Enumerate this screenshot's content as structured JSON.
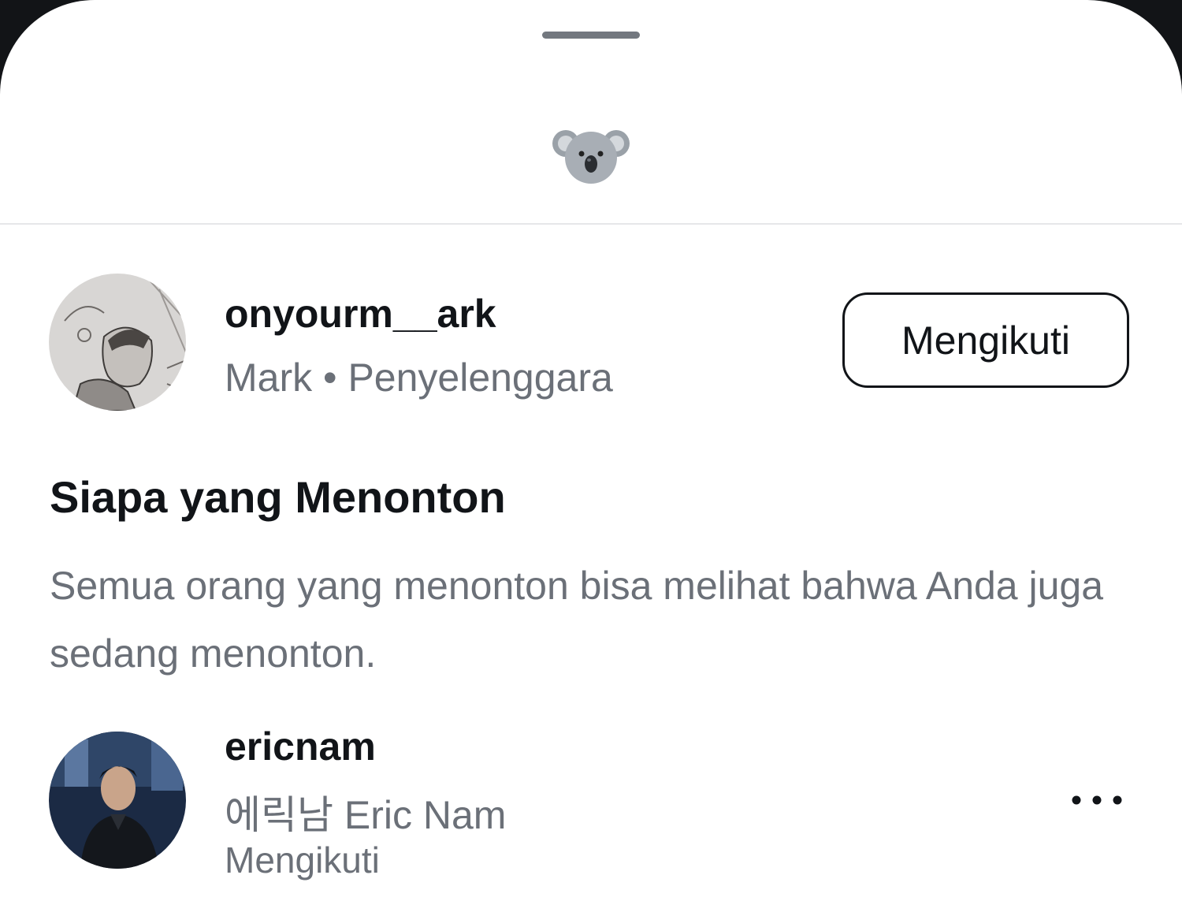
{
  "header": {
    "emoji": "🐨",
    "emoji_icon": "koala-icon"
  },
  "host": {
    "username": "onyourm__ark",
    "name": "Mark",
    "separator": "•",
    "role": "Penyelenggara",
    "follow_label": "Mengikuti"
  },
  "section": {
    "title": "Siapa yang Menonton",
    "description": "Semua orang yang menonton bisa melihat bahwa Anda juga sedang menonton."
  },
  "viewers": [
    {
      "username": "ericnam",
      "display_name": "에릭남 Eric Nam",
      "status": "Mengikuti",
      "more_icon": "more-horizontal-icon"
    }
  ],
  "colors": {
    "sheet_background": "#ffffff",
    "backdrop": "#121417",
    "primary_text": "#111418",
    "secondary_text": "#6b7078",
    "divider": "#e6e7e9"
  }
}
